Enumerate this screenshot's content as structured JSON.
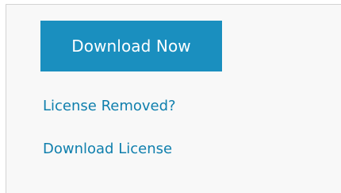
{
  "panel": {
    "download_button_label": "Download Now",
    "links": [
      {
        "label": "License Removed?"
      },
      {
        "label": "Download License"
      }
    ]
  },
  "colors": {
    "button_background": "#1a8fbf",
    "button_text": "#ffffff",
    "link_text": "#0f7fad",
    "panel_background": "#f8f8f8",
    "panel_border": "#d3d3d3"
  }
}
